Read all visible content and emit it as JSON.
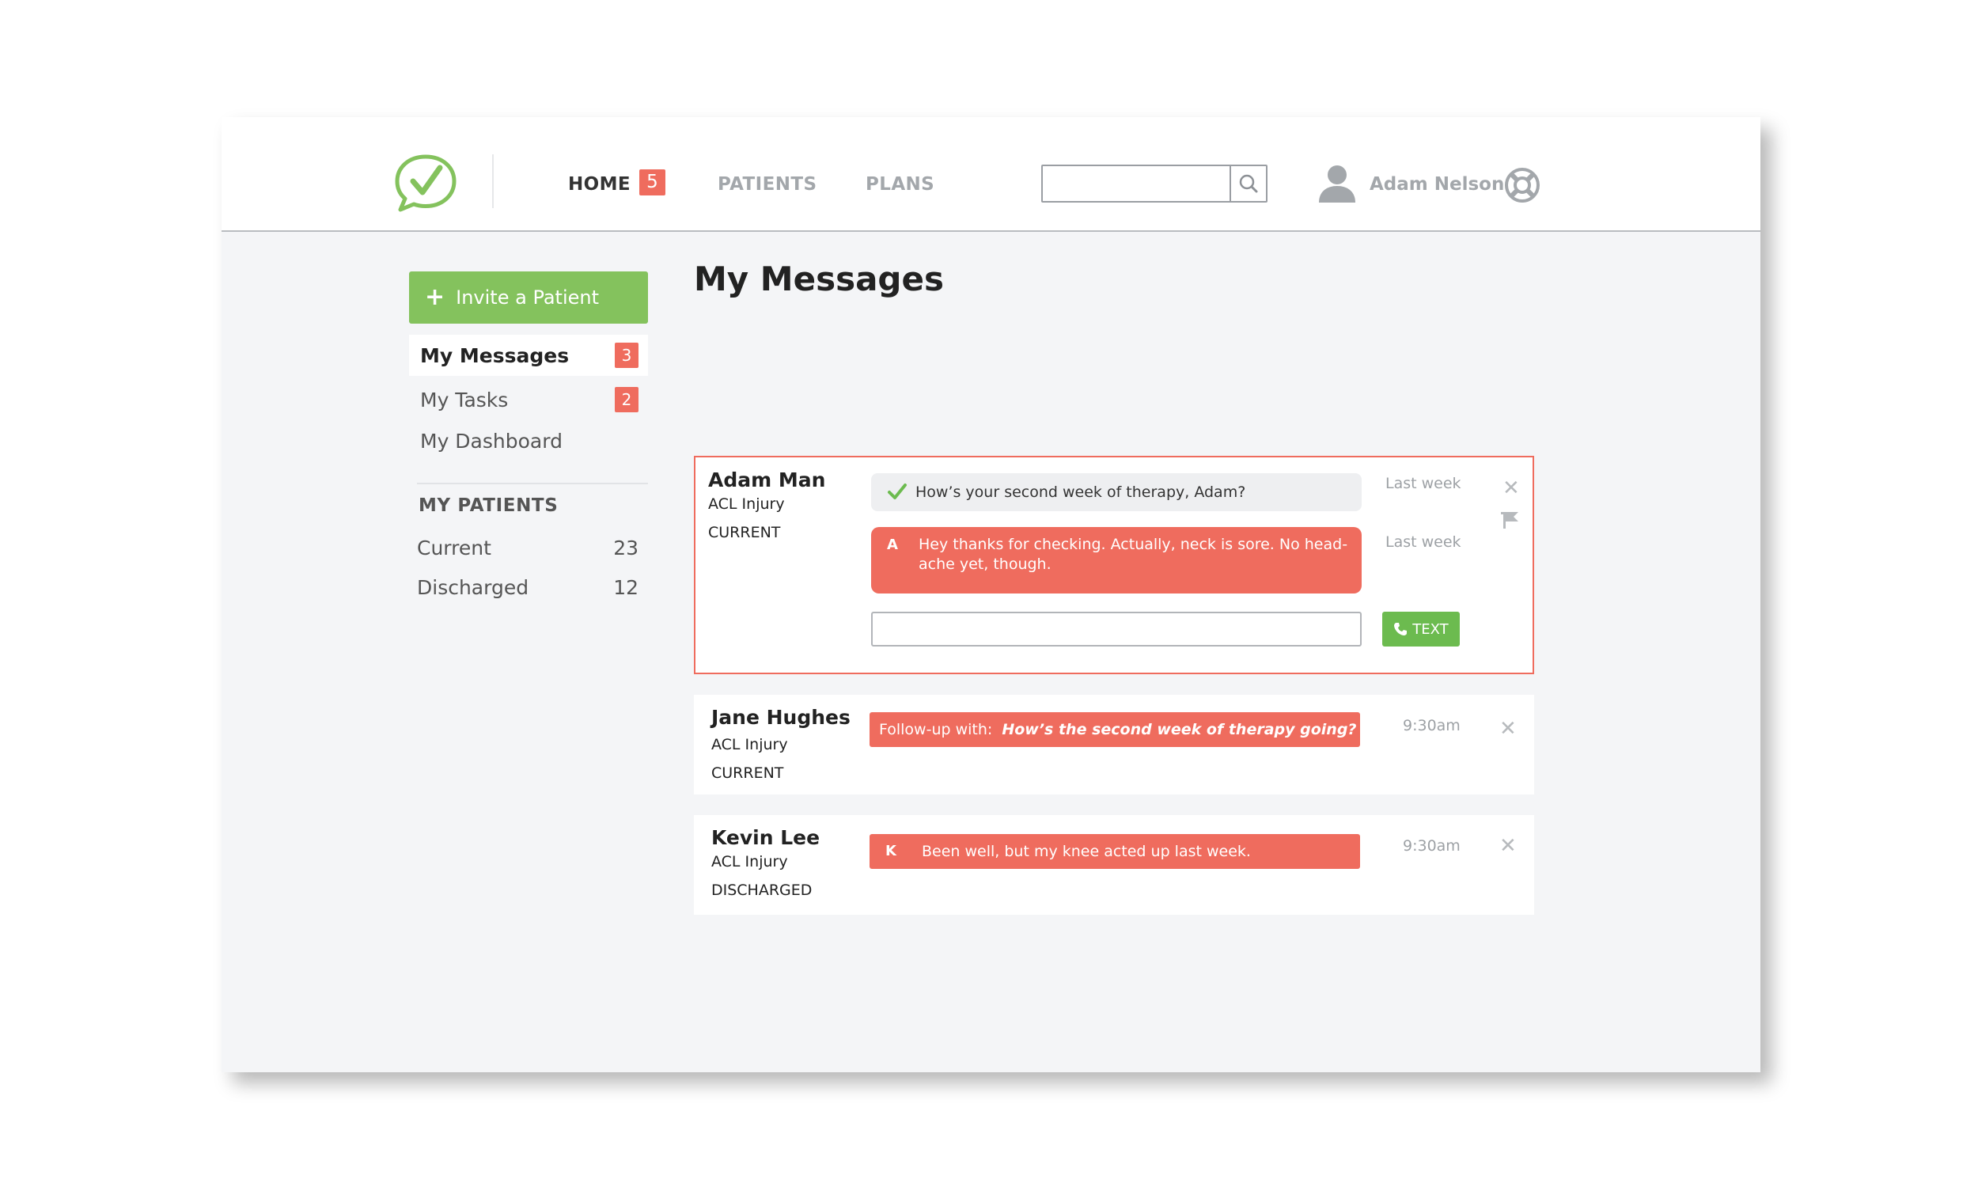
{
  "colors": {
    "brand_green": "#84c25d",
    "alert_red": "#ef6c5e",
    "text_button_green": "#6cbb4f",
    "muted_text": "#a3a7ab",
    "background": "#f4f5f7"
  },
  "header": {
    "logo_icon": "speech-bubble-checkmark-icon",
    "nav": {
      "home": "HOME",
      "home_badge": "5",
      "patients": "PATIENTS",
      "plans": "PLANS"
    },
    "search": {
      "value": "",
      "placeholder": "",
      "icon": "search-icon"
    },
    "user": {
      "name": "Adam Nelson",
      "avatar_icon": "user-icon"
    },
    "help_icon": "lifebuoy-icon"
  },
  "sidebar": {
    "invite_label": "Invite a Patient",
    "menu": [
      {
        "label": "My Messages",
        "badge": "3",
        "active": true
      },
      {
        "label": "My Tasks",
        "badge": "2",
        "active": false
      },
      {
        "label": "My Dashboard",
        "badge": "",
        "active": false
      }
    ],
    "patients_title": "MY PATIENTS",
    "patients": [
      {
        "label": "Current",
        "count": "23"
      },
      {
        "label": "Discharged",
        "count": "12"
      }
    ]
  },
  "main": {
    "title": "My Messages",
    "messages": [
      {
        "name": "Adam Man",
        "condition": "ACL Injury",
        "status": "CURRENT",
        "thread": [
          {
            "type": "sent",
            "text": "How’s your second week of therapy, Adam?",
            "time": "Last week"
          },
          {
            "type": "received",
            "initial": "A",
            "text_line1": "Hey thanks for checking. Actually, neck is sore. No head-",
            "text_line2": "ache yet, though.",
            "time": "Last week"
          }
        ],
        "reply": {
          "value": "",
          "placeholder": "",
          "button_label": "TEXT"
        }
      },
      {
        "name": "Jane Hughes",
        "condition": "ACL Injury",
        "status": "CURRENT",
        "prefix": "Follow-up with:",
        "text": "How’s the second week of therapy going?",
        "time": "9:30am"
      },
      {
        "name": "Kevin Lee",
        "condition": "ACL Injury",
        "status": "DISCHARGED",
        "initial": "K",
        "text": "Been well, but my knee acted up last week.",
        "time": "9:30am"
      }
    ]
  }
}
